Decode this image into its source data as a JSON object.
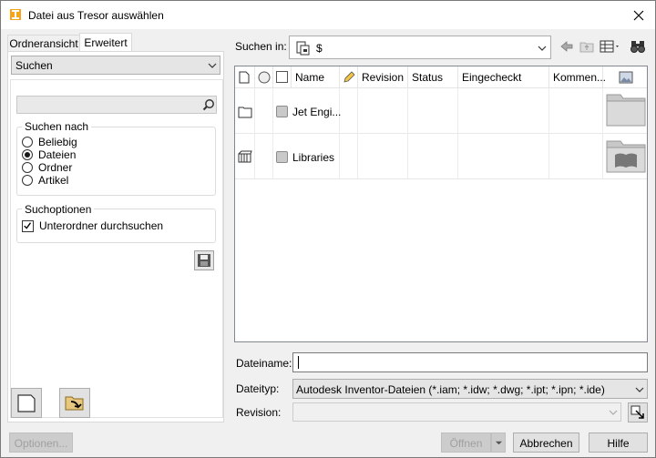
{
  "window": {
    "title": "Datei aus Tresor auswählen"
  },
  "tabs": [
    {
      "label": "Ordneransicht"
    },
    {
      "label": "Erweitert"
    }
  ],
  "left": {
    "mode_select": "Suchen",
    "search_value": "",
    "search_for": {
      "title": "Suchen nach",
      "options": [
        {
          "label": "Beliebig"
        },
        {
          "label": "Dateien"
        },
        {
          "label": "Ordner"
        },
        {
          "label": "Artikel"
        }
      ],
      "selected": "Dateien"
    },
    "search_options": {
      "title": "Suchoptionen",
      "subfolders_label": "Unterordner durchsuchen",
      "subfolders_checked": true
    }
  },
  "look_in": {
    "label": "Suchen in:",
    "value": "$"
  },
  "columns": [
    {
      "label": "Name"
    },
    {
      "label": "Revision"
    },
    {
      "label": "Status"
    },
    {
      "label": "Eingecheckt"
    },
    {
      "label": "Kommen..."
    }
  ],
  "rows": [
    {
      "name": "Jet Engi...",
      "icon": "folder-icon",
      "thumb": "folder-thumbnail"
    },
    {
      "name": "Libraries",
      "icon": "library-icon",
      "thumb": "library-folder-thumbnail"
    }
  ],
  "fields": {
    "filename_label": "Dateiname:",
    "filename_value": "",
    "filetype_label": "Dateityp:",
    "filetype_value": "Autodesk Inventor-Dateien (*.iam; *.idw; *.dwg; *.ipt; *.ipn; *.ide)",
    "revision_label": "Revision:",
    "revision_value": ""
  },
  "buttons": {
    "options": "Optionen...",
    "open": "Öffnen",
    "cancel": "Abbrechen",
    "help": "Hilfe"
  }
}
